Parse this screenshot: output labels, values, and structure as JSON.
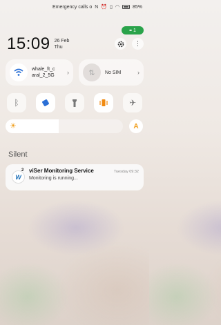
{
  "status_bar": {
    "carrier_text": "Emergency calls o",
    "battery": "85%"
  },
  "edit_pill": {
    "label": "1"
  },
  "clock": {
    "time": "15:09",
    "date_line1": "26 Feb",
    "date_line2": "Thu"
  },
  "tiles": {
    "wifi": {
      "label": "whale_ft_c aral_2_5G"
    },
    "sim": {
      "label": "No SIM"
    }
  },
  "quick_settings": [
    "bluetooth",
    "auto-rotate",
    "flashlight",
    "vibrate",
    "airplane-mode"
  ],
  "brightness": {
    "level": 0.45,
    "auto_label": "A"
  },
  "section": {
    "title": "Silent"
  },
  "notification": {
    "app_name": "viSer Monitoring Service",
    "time": "Tuesday 09:32",
    "body": "Monitoring is running...",
    "badge": "2"
  },
  "colors": {
    "accent_green": "#2aa34a",
    "accent_blue": "#2a6fd6",
    "accent_orange": "#f08a10"
  }
}
